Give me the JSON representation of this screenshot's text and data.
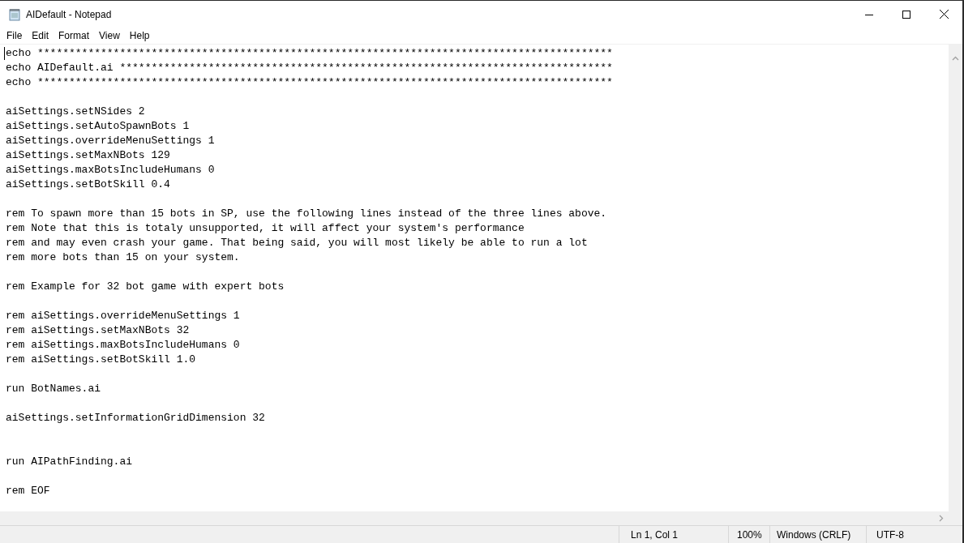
{
  "window": {
    "title": "AIDefault - Notepad"
  },
  "menu": [
    "File",
    "Edit",
    "Format",
    "View",
    "Help"
  ],
  "editor": {
    "lines": [
      {
        "kind": "text",
        "text": "echo *******************************************************************************************"
      },
      {
        "kind": "text",
        "text": "echo AIDefault.ai ******************************************************************************"
      },
      {
        "kind": "text",
        "text": "echo *******************************************************************************************"
      },
      {
        "kind": "blank"
      },
      {
        "kind": "text",
        "text": "aiSettings.setNSides 2"
      },
      {
        "kind": "text",
        "text": "aiSettings.setAutoSpawnBots 1"
      },
      {
        "kind": "text",
        "text": "aiSettings.overrideMenuSettings 1"
      },
      {
        "kind": "text",
        "text": "aiSettings.setMaxNBots 129"
      },
      {
        "kind": "text",
        "text": "aiSettings.maxBotsIncludeHumans 0"
      },
      {
        "kind": "text",
        "text": "aiSettings.setBotSkill 0.4"
      },
      {
        "kind": "blank"
      },
      {
        "kind": "text",
        "text": "rem To spawn more than 15 bots in SP, use the following lines instead of the three lines above."
      },
      {
        "kind": "text",
        "text": "rem Note that this is totaly unsupported, it will affect your system's performance"
      },
      {
        "kind": "text",
        "text": "rem and may even crash your game. That being said, you will most likely be able to run a lot"
      },
      {
        "kind": "text",
        "text": "rem more bots than 15 on your system."
      },
      {
        "kind": "blank"
      },
      {
        "kind": "text",
        "text": "rem Example for 32 bot game with expert bots"
      },
      {
        "kind": "blank"
      },
      {
        "kind": "text",
        "text": "rem aiSettings.overrideMenuSettings 1"
      },
      {
        "kind": "text",
        "text": "rem aiSettings.setMaxNBots 32"
      },
      {
        "kind": "text",
        "text": "rem aiSettings.maxBotsIncludeHumans 0"
      },
      {
        "kind": "text",
        "text": "rem aiSettings.setBotSkill 1.0"
      },
      {
        "kind": "blank"
      },
      {
        "kind": "text",
        "text": "run BotNames.ai"
      },
      {
        "kind": "blank"
      },
      {
        "kind": "text",
        "text": "aiSettings.setInformationGridDimension 32"
      },
      {
        "kind": "blank"
      },
      {
        "kind": "blank"
      },
      {
        "kind": "text",
        "text": "run AIPathFinding.ai"
      },
      {
        "kind": "blank"
      },
      {
        "kind": "text",
        "text": "rem EOF"
      }
    ]
  },
  "status_bar": {
    "position": "Ln 1, Col 1",
    "zoom": "100%",
    "line_ending": "Windows (CRLF)",
    "encoding": "UTF-8"
  }
}
